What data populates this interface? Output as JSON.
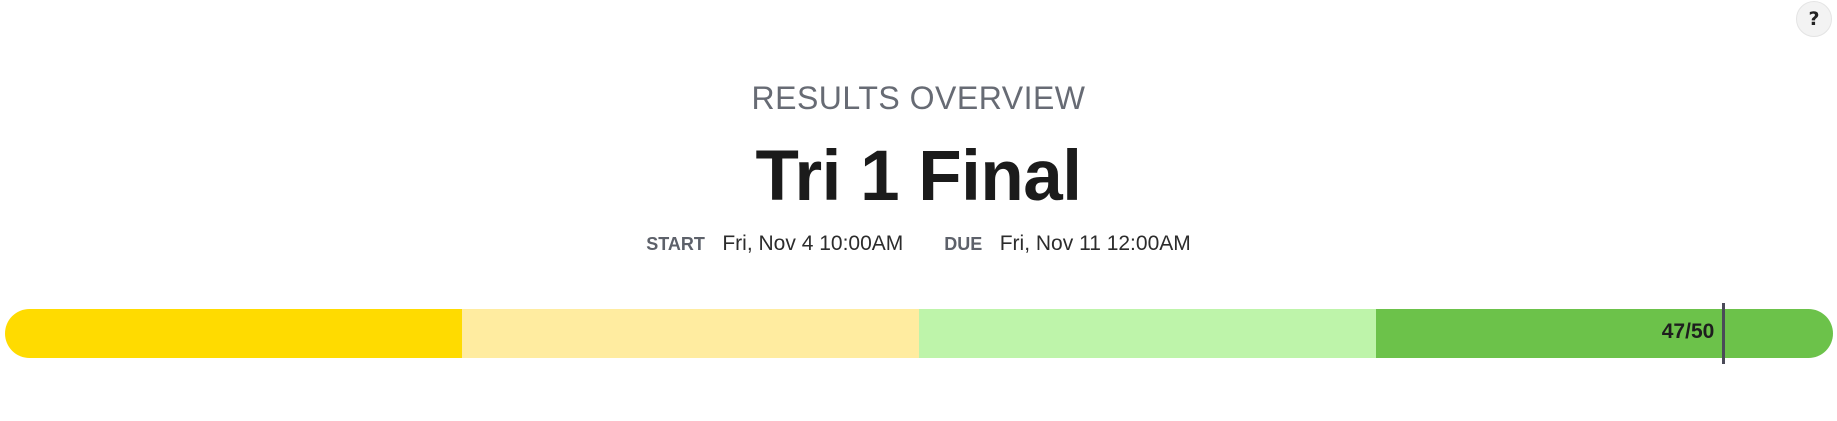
{
  "header": {
    "help_label": "?"
  },
  "overview": {
    "overline": "RESULTS OVERVIEW",
    "title": "Tri 1 Final",
    "start_label": "START",
    "start_value": "Fri, Nov 4 10:00AM",
    "due_label": "DUE",
    "due_value": "Fri, Nov 11 12:00AM"
  },
  "progress": {
    "score_label": "47/50",
    "score": 47,
    "max": 50,
    "segments": [
      {
        "color": "#ffdb00"
      },
      {
        "color": "#ffeca0"
      },
      {
        "color": "#bef4aa"
      },
      {
        "color": "#6cc24a"
      }
    ]
  }
}
